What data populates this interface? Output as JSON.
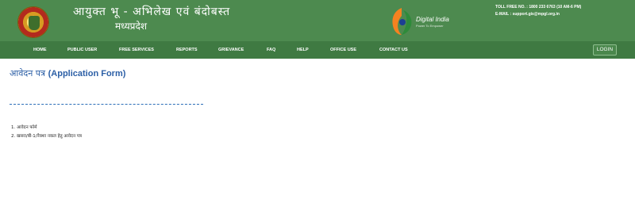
{
  "header": {
    "title_hindi": "आयुक्त भू - अभिलेख एवं बंदोबस्त",
    "subtitle_hindi": "मध्यप्रदेश",
    "digital_india": {
      "name": "Digital India",
      "tagline": "Power To Empower"
    },
    "contact": {
      "toll_free": "TOLL FREE NO. : 1800 233 6763 (10 AM-6 PM)",
      "email": "E-MAIL : support.gis@mpgl.org.in"
    }
  },
  "nav": {
    "items": [
      {
        "label": "HOME"
      },
      {
        "label": "PUBLIC USER"
      },
      {
        "label": "FREE SERVICES"
      },
      {
        "label": "REPORTS"
      },
      {
        "label": "GRIEVANCE"
      },
      {
        "label": "FAQ"
      },
      {
        "label": "HELP"
      },
      {
        "label": "OFFICE USE"
      },
      {
        "label": "CONTACT US"
      }
    ],
    "login_label": "LOGIN"
  },
  "main": {
    "title_hindi": "आवेदन पत्र",
    "title_english": "(Application Form)",
    "links": [
      {
        "number": "1.",
        "label": "आवेदन फॉर्म"
      },
      {
        "number": "2.",
        "label": "खसरा/बी-1/नैक्शा नकल हेतु आवेदन पत्र"
      }
    ]
  },
  "colors": {
    "header_bg": "#4d8a4f",
    "nav_bg": "#3f7a42",
    "title_blue": "#2c5fa6",
    "divider_blue": "#2c6fb8"
  }
}
